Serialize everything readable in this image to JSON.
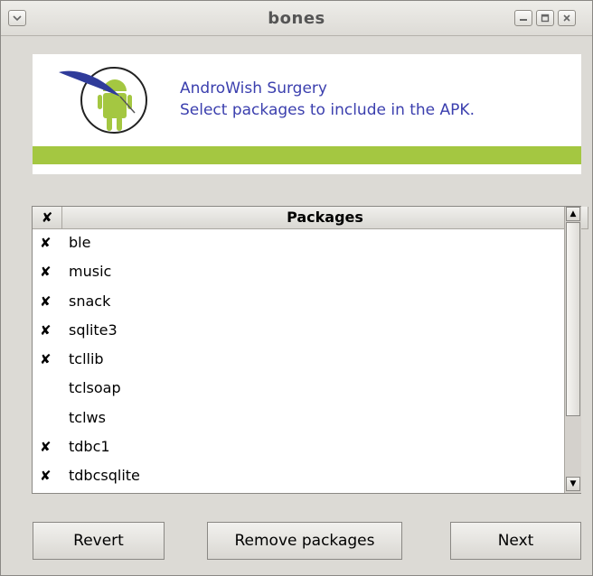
{
  "window": {
    "title": "bones"
  },
  "banner": {
    "line1": "AndroWish Surgery",
    "line2": "Select packages to include in the APK.",
    "accent_color": "#a4c741",
    "text_color": "#3b3fae"
  },
  "list": {
    "header_check": "✘",
    "header_packages": "Packages",
    "rows": [
      {
        "checked": "✘",
        "name": "ble"
      },
      {
        "checked": "✘",
        "name": "music"
      },
      {
        "checked": "✘",
        "name": "snack"
      },
      {
        "checked": "✘",
        "name": "sqlite3"
      },
      {
        "checked": "✘",
        "name": "tcllib"
      },
      {
        "checked": "",
        "name": "tclsoap"
      },
      {
        "checked": "",
        "name": "tclws"
      },
      {
        "checked": "✘",
        "name": "tdbc1"
      },
      {
        "checked": "✘",
        "name": "tdbcsqlite"
      }
    ]
  },
  "buttons": {
    "revert": "Revert",
    "remove": "Remove packages",
    "next": "Next"
  },
  "icons": {
    "window_menu": "chevron-down-icon",
    "minimize": "minimize-icon",
    "maximize": "maximize-icon",
    "close": "close-icon",
    "logo": "androwish-logo-icon"
  }
}
